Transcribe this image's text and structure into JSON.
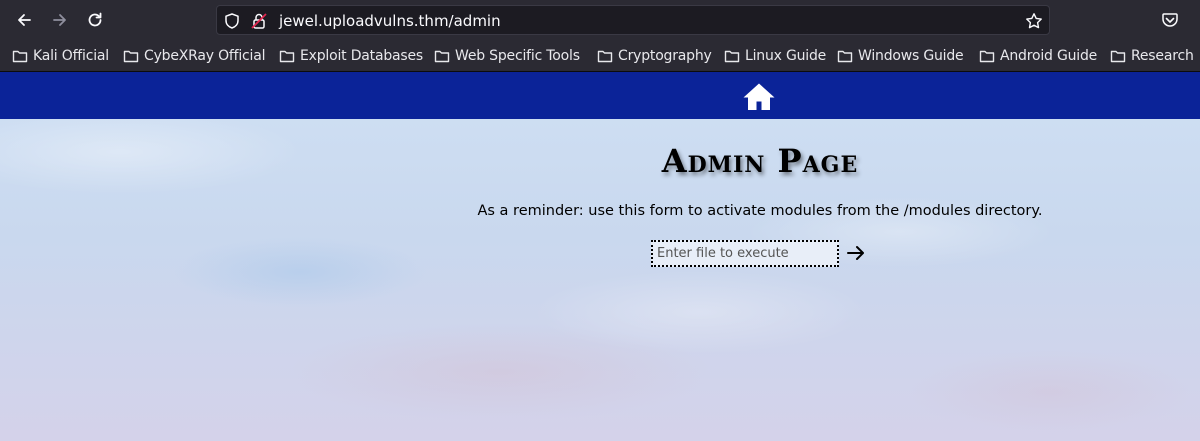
{
  "browser": {
    "url": "jewel.uploadvulns.thm/admin",
    "bookmarks": [
      "Kali Official",
      "CybeXRay Official",
      "Exploit Databases",
      "Web Specific Tools",
      "Cryptography",
      "Linux Guide",
      "Windows Guide",
      "Android Guide",
      "Research"
    ],
    "icons": [
      "back-arrow-icon",
      "forward-arrow-icon",
      "reload-icon",
      "shield-icon",
      "insecure-lock-icon",
      "star-icon",
      "pocket-icon",
      "folder-icon"
    ]
  },
  "site": {
    "nav": {
      "home_icon": "home-icon"
    },
    "title": "Admin Page",
    "reminder": "As a reminder: use this form to activate modules from the /modules directory.",
    "form": {
      "placeholder": "Enter file to execute",
      "value": "",
      "submit_icon": "arrow-right-icon"
    }
  },
  "colors": {
    "navbar": "#0b2398",
    "browser_chrome": "#2b2a33",
    "page_background": "#cfe0f4"
  }
}
